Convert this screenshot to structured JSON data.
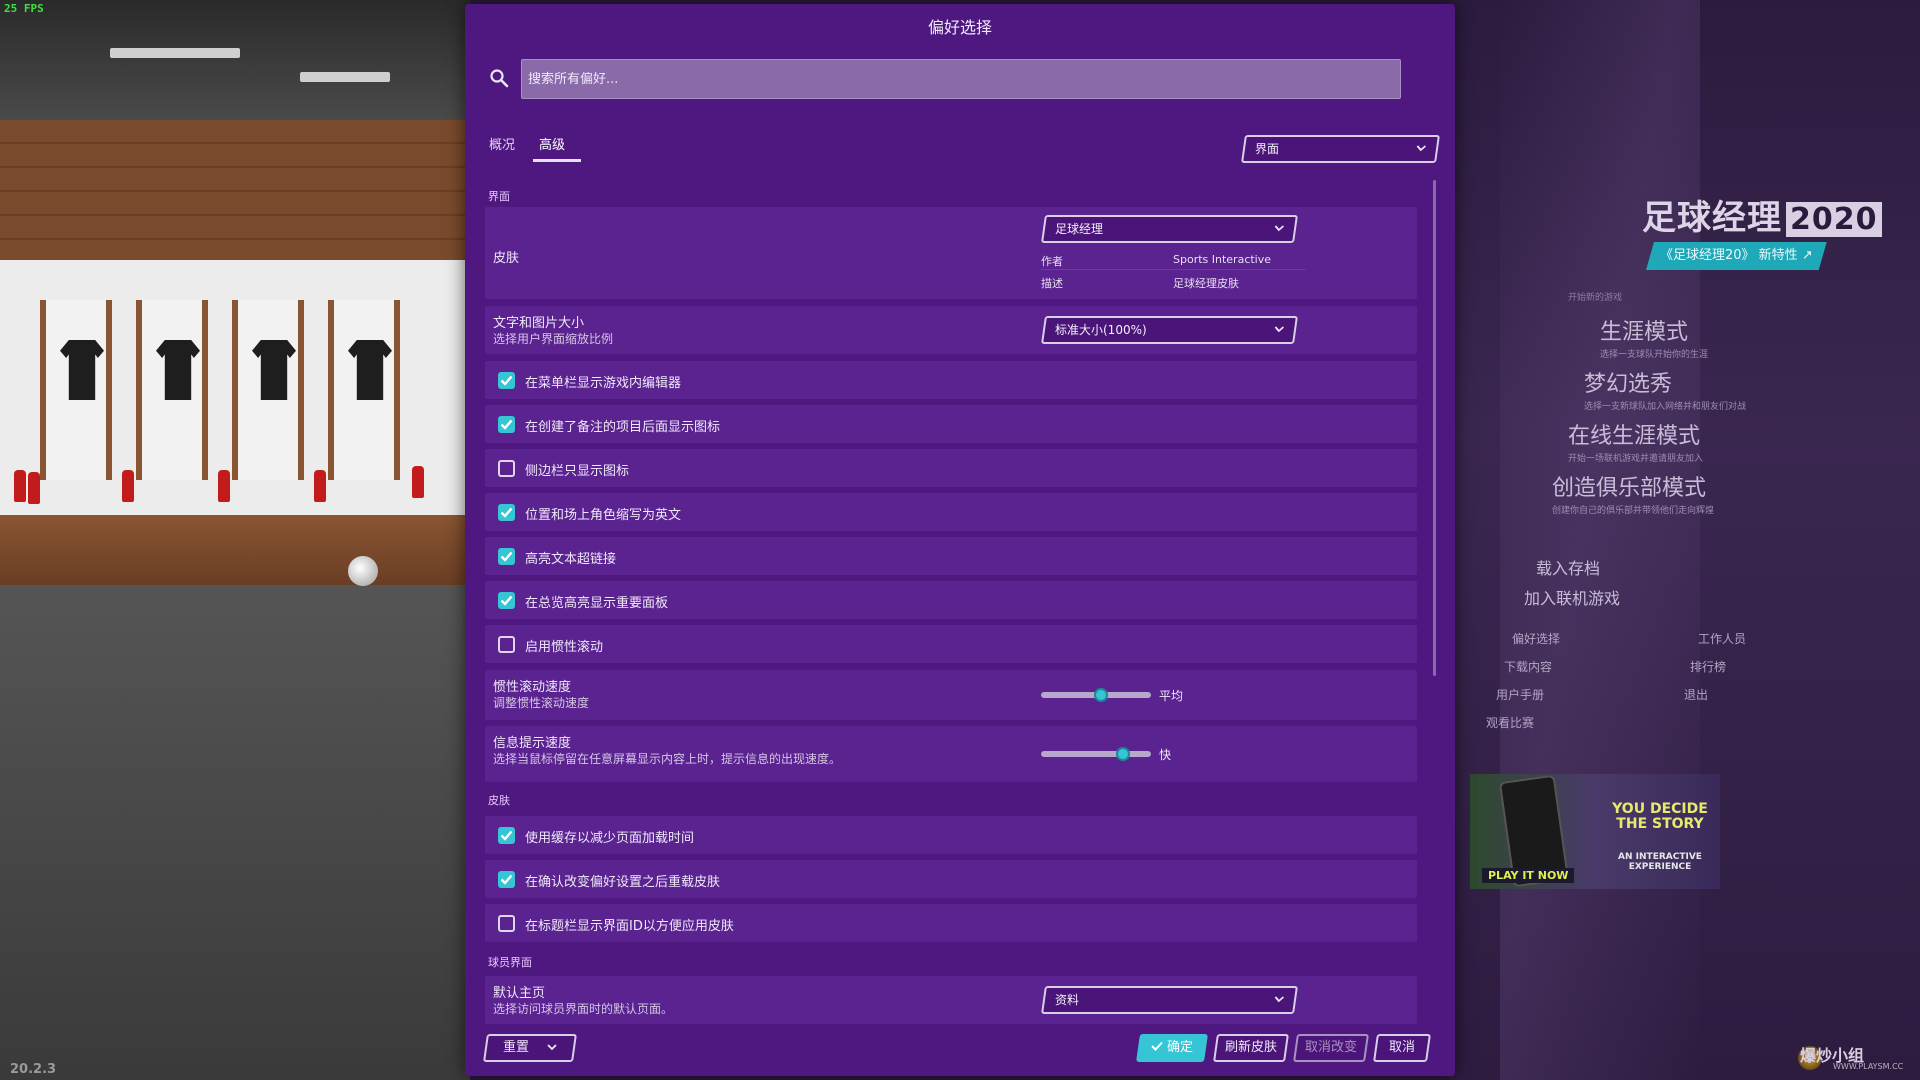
{
  "overlay": {
    "fps": "25 FPS",
    "version": "20.2.3"
  },
  "dialog": {
    "title": "偏好选择",
    "search_placeholder": "搜索所有偏好...",
    "tabs": [
      {
        "label": "概况",
        "active": false
      },
      {
        "label": "高级",
        "active": true
      }
    ],
    "category_select": "界面",
    "sections": {
      "interface": "界面",
      "skin": "皮肤",
      "player_interface": "球员界面"
    },
    "skin_row": {
      "title": "皮肤",
      "select_value": "足球经理",
      "author_key": "作者",
      "author_value": "Sports Interactive",
      "desc_key": "描述",
      "desc_value": "足球经理皮肤"
    },
    "text_size_row": {
      "title": "文字和图片大小",
      "subtitle": "选择用户界面缩放比例",
      "select_value": "标准大小(100%)"
    },
    "interface_checkboxes": [
      {
        "label": "在菜单栏显示游戏内编辑器",
        "checked": true
      },
      {
        "label": "在创建了备注的项目后面显示图标",
        "checked": true
      },
      {
        "label": "侧边栏只显示图标",
        "checked": false
      },
      {
        "label": "位置和场上角色缩写为英文",
        "checked": true
      },
      {
        "label": "高亮文本超链接",
        "checked": true
      },
      {
        "label": "在总览高亮显示重要面板",
        "checked": true
      },
      {
        "label": "启用惯性滚动",
        "checked": false
      }
    ],
    "inertia_speed": {
      "title": "惯性滚动速度",
      "subtitle": "调整惯性滚动速度",
      "value_label": "平均",
      "level": 0.55
    },
    "tooltip_speed": {
      "title": "信息提示速度",
      "subtitle": "选择当鼠标停留在任意屏幕显示内容上时，提示信息的出现速度。",
      "value_label": "快",
      "level": 0.78
    },
    "skin_checkboxes": [
      {
        "label": "使用缓存以减少页面加载时间",
        "checked": true
      },
      {
        "label": "在确认改变偏好设置之后重载皮肤",
        "checked": true
      },
      {
        "label": "在标题栏显示界面ID以方便应用皮肤",
        "checked": false
      }
    ],
    "default_home": {
      "title": "默认主页",
      "subtitle": "选择访问球员界面时的默认页面。",
      "select_value": "资料"
    },
    "footer": {
      "reset": "重置",
      "confirm": "确定",
      "refresh_skin": "刷新皮肤",
      "cancel_changes": "取消改变",
      "cancel": "取消"
    }
  },
  "main_menu": {
    "brand": "足球经理",
    "brand_year": "2020",
    "whats_new": "《足球经理20》 新特性",
    "caption": "开始新的游戏",
    "modes": [
      {
        "title": "生涯模式",
        "subtitle": "选择一支球队开始你的生涯"
      },
      {
        "title": "梦幻选秀",
        "subtitle": "选择一支新球队加入网络并和朋友们对战"
      },
      {
        "title": "在线生涯模式",
        "subtitle": "开始一场联机游戏并邀请朋友加入"
      },
      {
        "title": "创造俱乐部模式",
        "subtitle": "创建你自己的俱乐部并带领他们走向辉煌"
      }
    ],
    "links": [
      "载入存档",
      "加入联机游戏"
    ],
    "small_links": [
      "偏好选择",
      "工作人员",
      "下载内容",
      "排行榜",
      "用户手册",
      "退出",
      "观看比赛"
    ],
    "promo": {
      "headline": "YOU DECIDE THE STORY",
      "sub": "AN INTERACTIVE EXPERIENCE",
      "cta": "PLAY IT NOW"
    },
    "watermark": "爆炒小组",
    "watermark_url": "WWW.PLAYSM.CC"
  },
  "colors": {
    "dialog_bg": "#4f1880",
    "panel_bg": "#5a2390",
    "accent": "#35c5d4",
    "search_bg": "#8a6aa8"
  }
}
